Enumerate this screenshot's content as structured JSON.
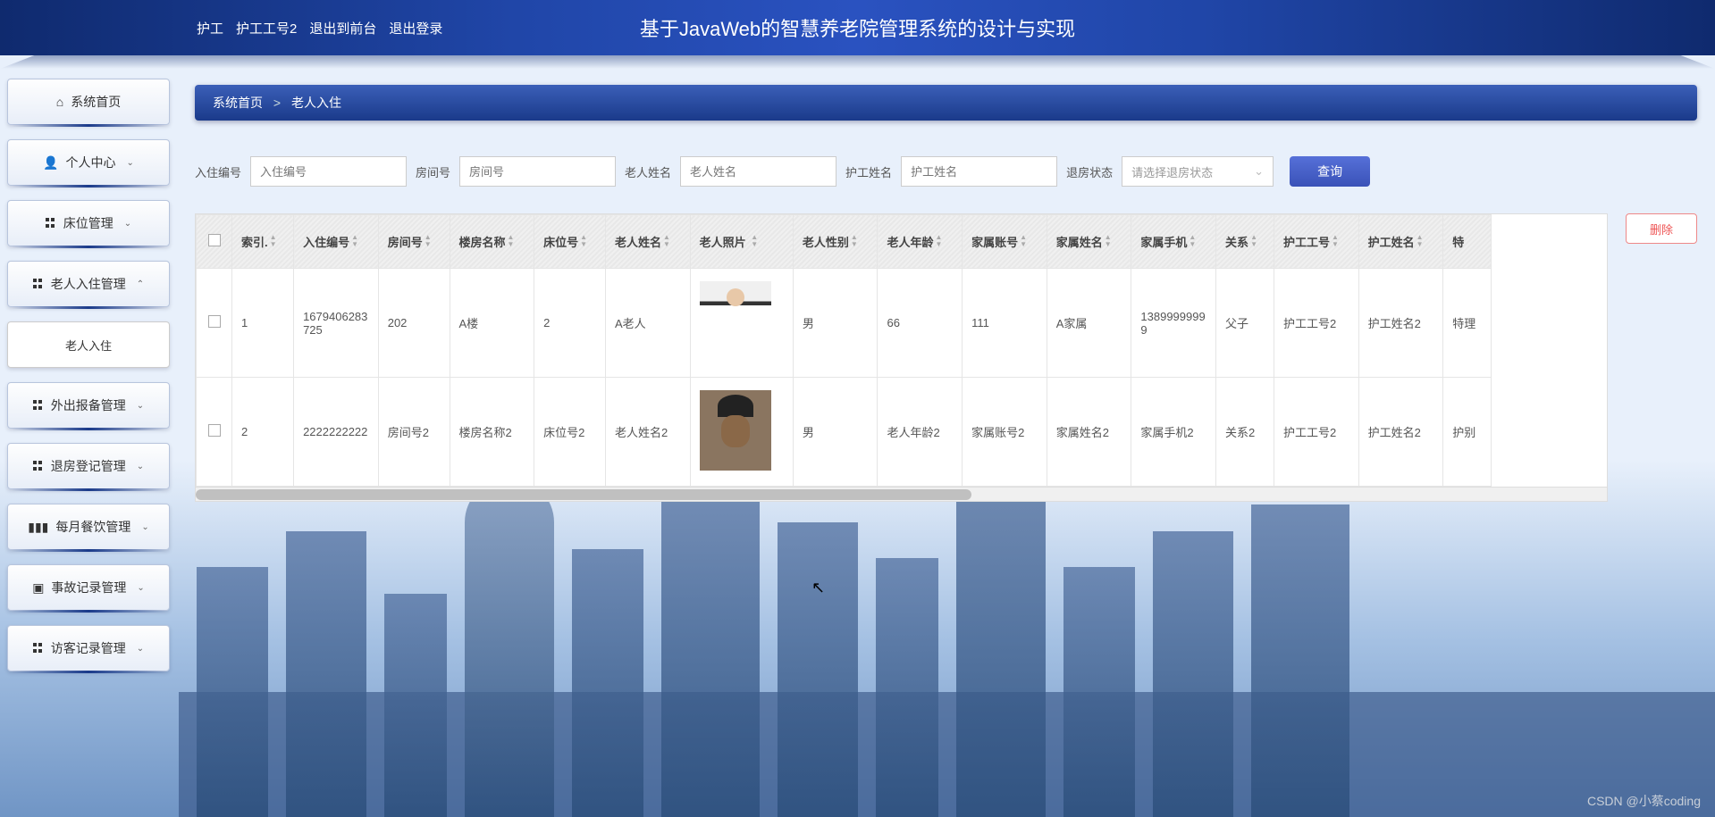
{
  "header": {
    "user_role": "护工",
    "user_id": "护工工号2",
    "logout_front": "退出到前台",
    "logout": "退出登录",
    "title": "基于JavaWeb的智慧养老院管理系统的设计与实现"
  },
  "sidebar": {
    "items": [
      {
        "label": "系统首页",
        "icon": "home",
        "expand": null
      },
      {
        "label": "个人中心",
        "icon": "person",
        "expand": "down"
      },
      {
        "label": "床位管理",
        "icon": "grid",
        "expand": "down"
      },
      {
        "label": "老人入住管理",
        "icon": "grid",
        "expand": "up"
      },
      {
        "label": "老人入住",
        "icon": null,
        "expand": null,
        "sub": true
      },
      {
        "label": "外出报备管理",
        "icon": "grid",
        "expand": "down"
      },
      {
        "label": "退房登记管理",
        "icon": "grid",
        "expand": "down"
      },
      {
        "label": "每月餐饮管理",
        "icon": "bars",
        "expand": "down"
      },
      {
        "label": "事故记录管理",
        "icon": "doc",
        "expand": "down"
      },
      {
        "label": "访客记录管理",
        "icon": "grid",
        "expand": "down"
      }
    ]
  },
  "breadcrumb": {
    "root": "系统首页",
    "current": "老人入住"
  },
  "search": {
    "f1_label": "入住编号",
    "f1_ph": "入住编号",
    "f2_label": "房间号",
    "f2_ph": "房间号",
    "f3_label": "老人姓名",
    "f3_ph": "老人姓名",
    "f4_label": "护工姓名",
    "f4_ph": "护工姓名",
    "f5_label": "退房状态",
    "f5_ph": "请选择退房状态",
    "query_btn": "查询"
  },
  "table": {
    "headers": [
      "索引.",
      "入住编号",
      "房间号",
      "楼房名称",
      "床位号",
      "老人姓名",
      "老人照片",
      "老人性别",
      "老人年龄",
      "家属账号",
      "家属姓名",
      "家属手机",
      "关系",
      "护工工号",
      "护工姓名",
      "特"
    ],
    "rows": [
      {
        "idx": "1",
        "code": "1679406283725",
        "room": "202",
        "bldg": "A楼",
        "bed": "2",
        "name": "A老人",
        "gender": "男",
        "age": "66",
        "famacc": "111",
        "famname": "A家属",
        "famphone": "13899999999",
        "rel": "父子",
        "nurseid": "护工工号2",
        "nursename": "护工姓名2",
        "extra": "特理"
      },
      {
        "idx": "2",
        "code": "2222222222",
        "room": "房间号2",
        "bldg": "楼房名称2",
        "bed": "床位号2",
        "name": "老人姓名2",
        "gender": "男",
        "age": "老人年龄2",
        "famacc": "家属账号2",
        "famname": "家属姓名2",
        "famphone": "家属手机2",
        "rel": "关系2",
        "nurseid": "护工工号2",
        "nursename": "护工姓名2",
        "extra": "护别"
      }
    ]
  },
  "actions": {
    "delete": "删除"
  },
  "watermark": "CSDN @小蔡coding"
}
